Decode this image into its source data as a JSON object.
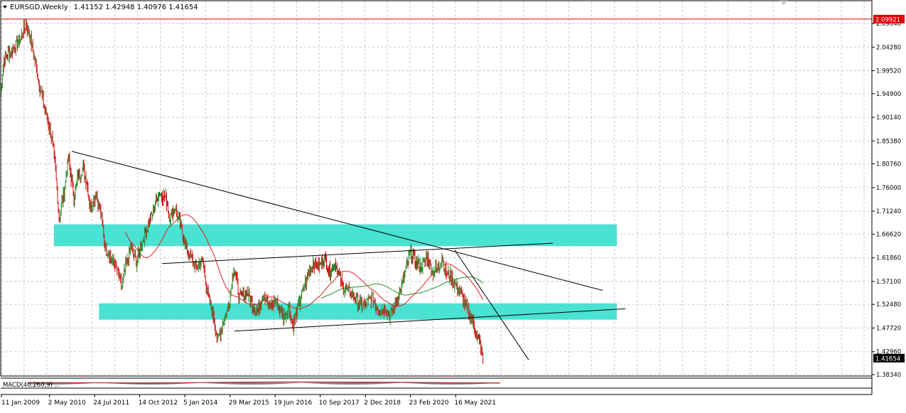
{
  "header": {
    "symbol_label": "EURSGD,Weekly",
    "ohlc_label": "1.41152 1.42948 1.40976 1.41654"
  },
  "chart": {
    "price_axis": {
      "ticks": [
        "2.09040",
        "2.04280",
        "1.99520",
        "1.94900",
        "1.90140",
        "1.85380",
        "1.80760",
        "1.76000",
        "1.71240",
        "1.66620",
        "1.61860",
        "1.57100",
        "1.52480",
        "1.47720",
        "1.42960",
        "1.38340"
      ],
      "tick_values": [
        2.0904,
        2.0428,
        1.9952,
        1.949,
        1.9014,
        1.8538,
        1.8076,
        1.76,
        1.7124,
        1.6662,
        1.6186,
        1.571,
        1.5248,
        1.4772,
        1.4296,
        1.3834
      ],
      "current_price": "1.41654",
      "current_price_value": 1.41654,
      "alert_price": "2.09921",
      "alert_price_value": 2.09921
    },
    "time_axis": {
      "labels": [
        "11 Jan 2009",
        "2 May 2010",
        "24 Jul 2011",
        "14 Oct 2012",
        "5 Jan 2014",
        "29 Mar 2015",
        "19 Jun 2016",
        "10 Sep 2017",
        "2 Dec 2018",
        "23 Feb 2020",
        "16 May 2021"
      ]
    },
    "zones": [
      {
        "from": "2 May 2010",
        "to": "2023",
        "low": 1.642,
        "high": 1.686
      },
      {
        "from": "24 Jul 2011",
        "to": "2023",
        "low": 1.494,
        "high": 1.527
      }
    ],
    "trendlines": [
      {
        "name": "upper-descending",
        "points": [
          [
            "Nov 2010",
            1.833
          ],
          [
            "Jun 2023",
            1.553
          ]
        ]
      },
      {
        "name": "rising-upper",
        "points": [
          [
            "Oct 2012",
            1.607
          ],
          [
            "2023",
            1.648
          ]
        ]
      },
      {
        "name": "rising-lower",
        "points": [
          [
            "Mar 2015",
            1.471
          ],
          [
            "2023",
            1.516
          ]
        ]
      },
      {
        "name": "steep-descending",
        "points": [
          [
            "Jul 2020",
            1.634
          ],
          [
            "2022",
            1.413
          ]
        ]
      }
    ],
    "colors": {
      "bull": "#2e8b2e",
      "bear": "#cc1111",
      "zone": "#40e0d0",
      "ma_red": "#dd2222",
      "ma_green": "#2a8a2a",
      "alert": "#dd0000",
      "grid": "#c8c8c8"
    }
  },
  "indicator": {
    "label": "MACD(40,260,9) ..."
  }
}
